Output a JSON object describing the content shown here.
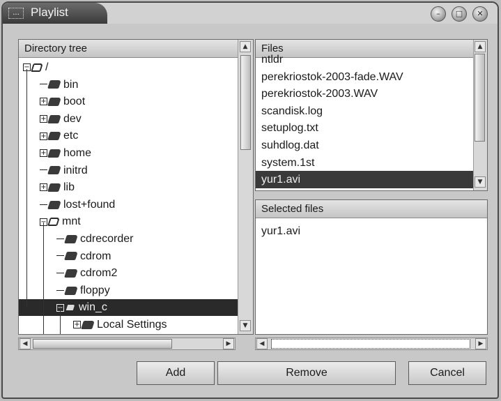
{
  "window": {
    "title": "Playlist",
    "title_icon": "...",
    "buttons": [
      {
        "name": "minimize-button",
        "glyph": "–"
      },
      {
        "name": "maximize-button",
        "glyph": "□"
      },
      {
        "name": "close-button",
        "glyph": "✕"
      }
    ]
  },
  "dir_tree": {
    "header": "Directory tree",
    "items": [
      {
        "label": "/",
        "depth": 0,
        "expander": "−",
        "open": true,
        "selected": false
      },
      {
        "label": "bin",
        "depth": 1,
        "expander": "",
        "open": false,
        "selected": false
      },
      {
        "label": "boot",
        "depth": 1,
        "expander": "+",
        "open": false,
        "selected": false
      },
      {
        "label": "dev",
        "depth": 1,
        "expander": "+",
        "open": false,
        "selected": false
      },
      {
        "label": "etc",
        "depth": 1,
        "expander": "+",
        "open": false,
        "selected": false
      },
      {
        "label": "home",
        "depth": 1,
        "expander": "+",
        "open": false,
        "selected": false
      },
      {
        "label": "initrd",
        "depth": 1,
        "expander": "",
        "open": false,
        "selected": false
      },
      {
        "label": "lib",
        "depth": 1,
        "expander": "+",
        "open": false,
        "selected": false
      },
      {
        "label": "lost+found",
        "depth": 1,
        "expander": "",
        "open": false,
        "selected": false
      },
      {
        "label": "mnt",
        "depth": 1,
        "expander": "−",
        "open": true,
        "selected": false
      },
      {
        "label": "cdrecorder",
        "depth": 2,
        "expander": "",
        "open": false,
        "selected": false
      },
      {
        "label": "cdrom",
        "depth": 2,
        "expander": "",
        "open": false,
        "selected": false
      },
      {
        "label": "cdrom2",
        "depth": 2,
        "expander": "",
        "open": false,
        "selected": false
      },
      {
        "label": "floppy",
        "depth": 2,
        "expander": "",
        "open": false,
        "selected": false
      },
      {
        "label": "win_c",
        "depth": 2,
        "expander": "−",
        "open": true,
        "selected": true
      },
      {
        "label": "Local Settings",
        "depth": 3,
        "expander": "+",
        "open": false,
        "selected": false
      }
    ]
  },
  "files": {
    "header": "Files",
    "items": [
      {
        "label": "ntldr",
        "selected": false
      },
      {
        "label": "perekriostok-2003-fade.WAV",
        "selected": false
      },
      {
        "label": "perekriostok-2003.WAV",
        "selected": false
      },
      {
        "label": "scandisk.log",
        "selected": false
      },
      {
        "label": "setuplog.txt",
        "selected": false
      },
      {
        "label": "suhdlog.dat",
        "selected": false
      },
      {
        "label": "system.1st",
        "selected": false
      },
      {
        "label": "yur1.avi",
        "selected": true
      }
    ]
  },
  "selected_files": {
    "header": "Selected files",
    "items": [
      "yur1.avi"
    ]
  },
  "buttons": {
    "add": "Add",
    "remove": "Remove",
    "cancel": "Cancel"
  },
  "scroll_glyphs": {
    "up": "▲",
    "down": "▼",
    "left": "◀",
    "right": "▶"
  },
  "colors": {
    "selection": "#2a2a2a",
    "title_bar": "#4a4a4a"
  }
}
